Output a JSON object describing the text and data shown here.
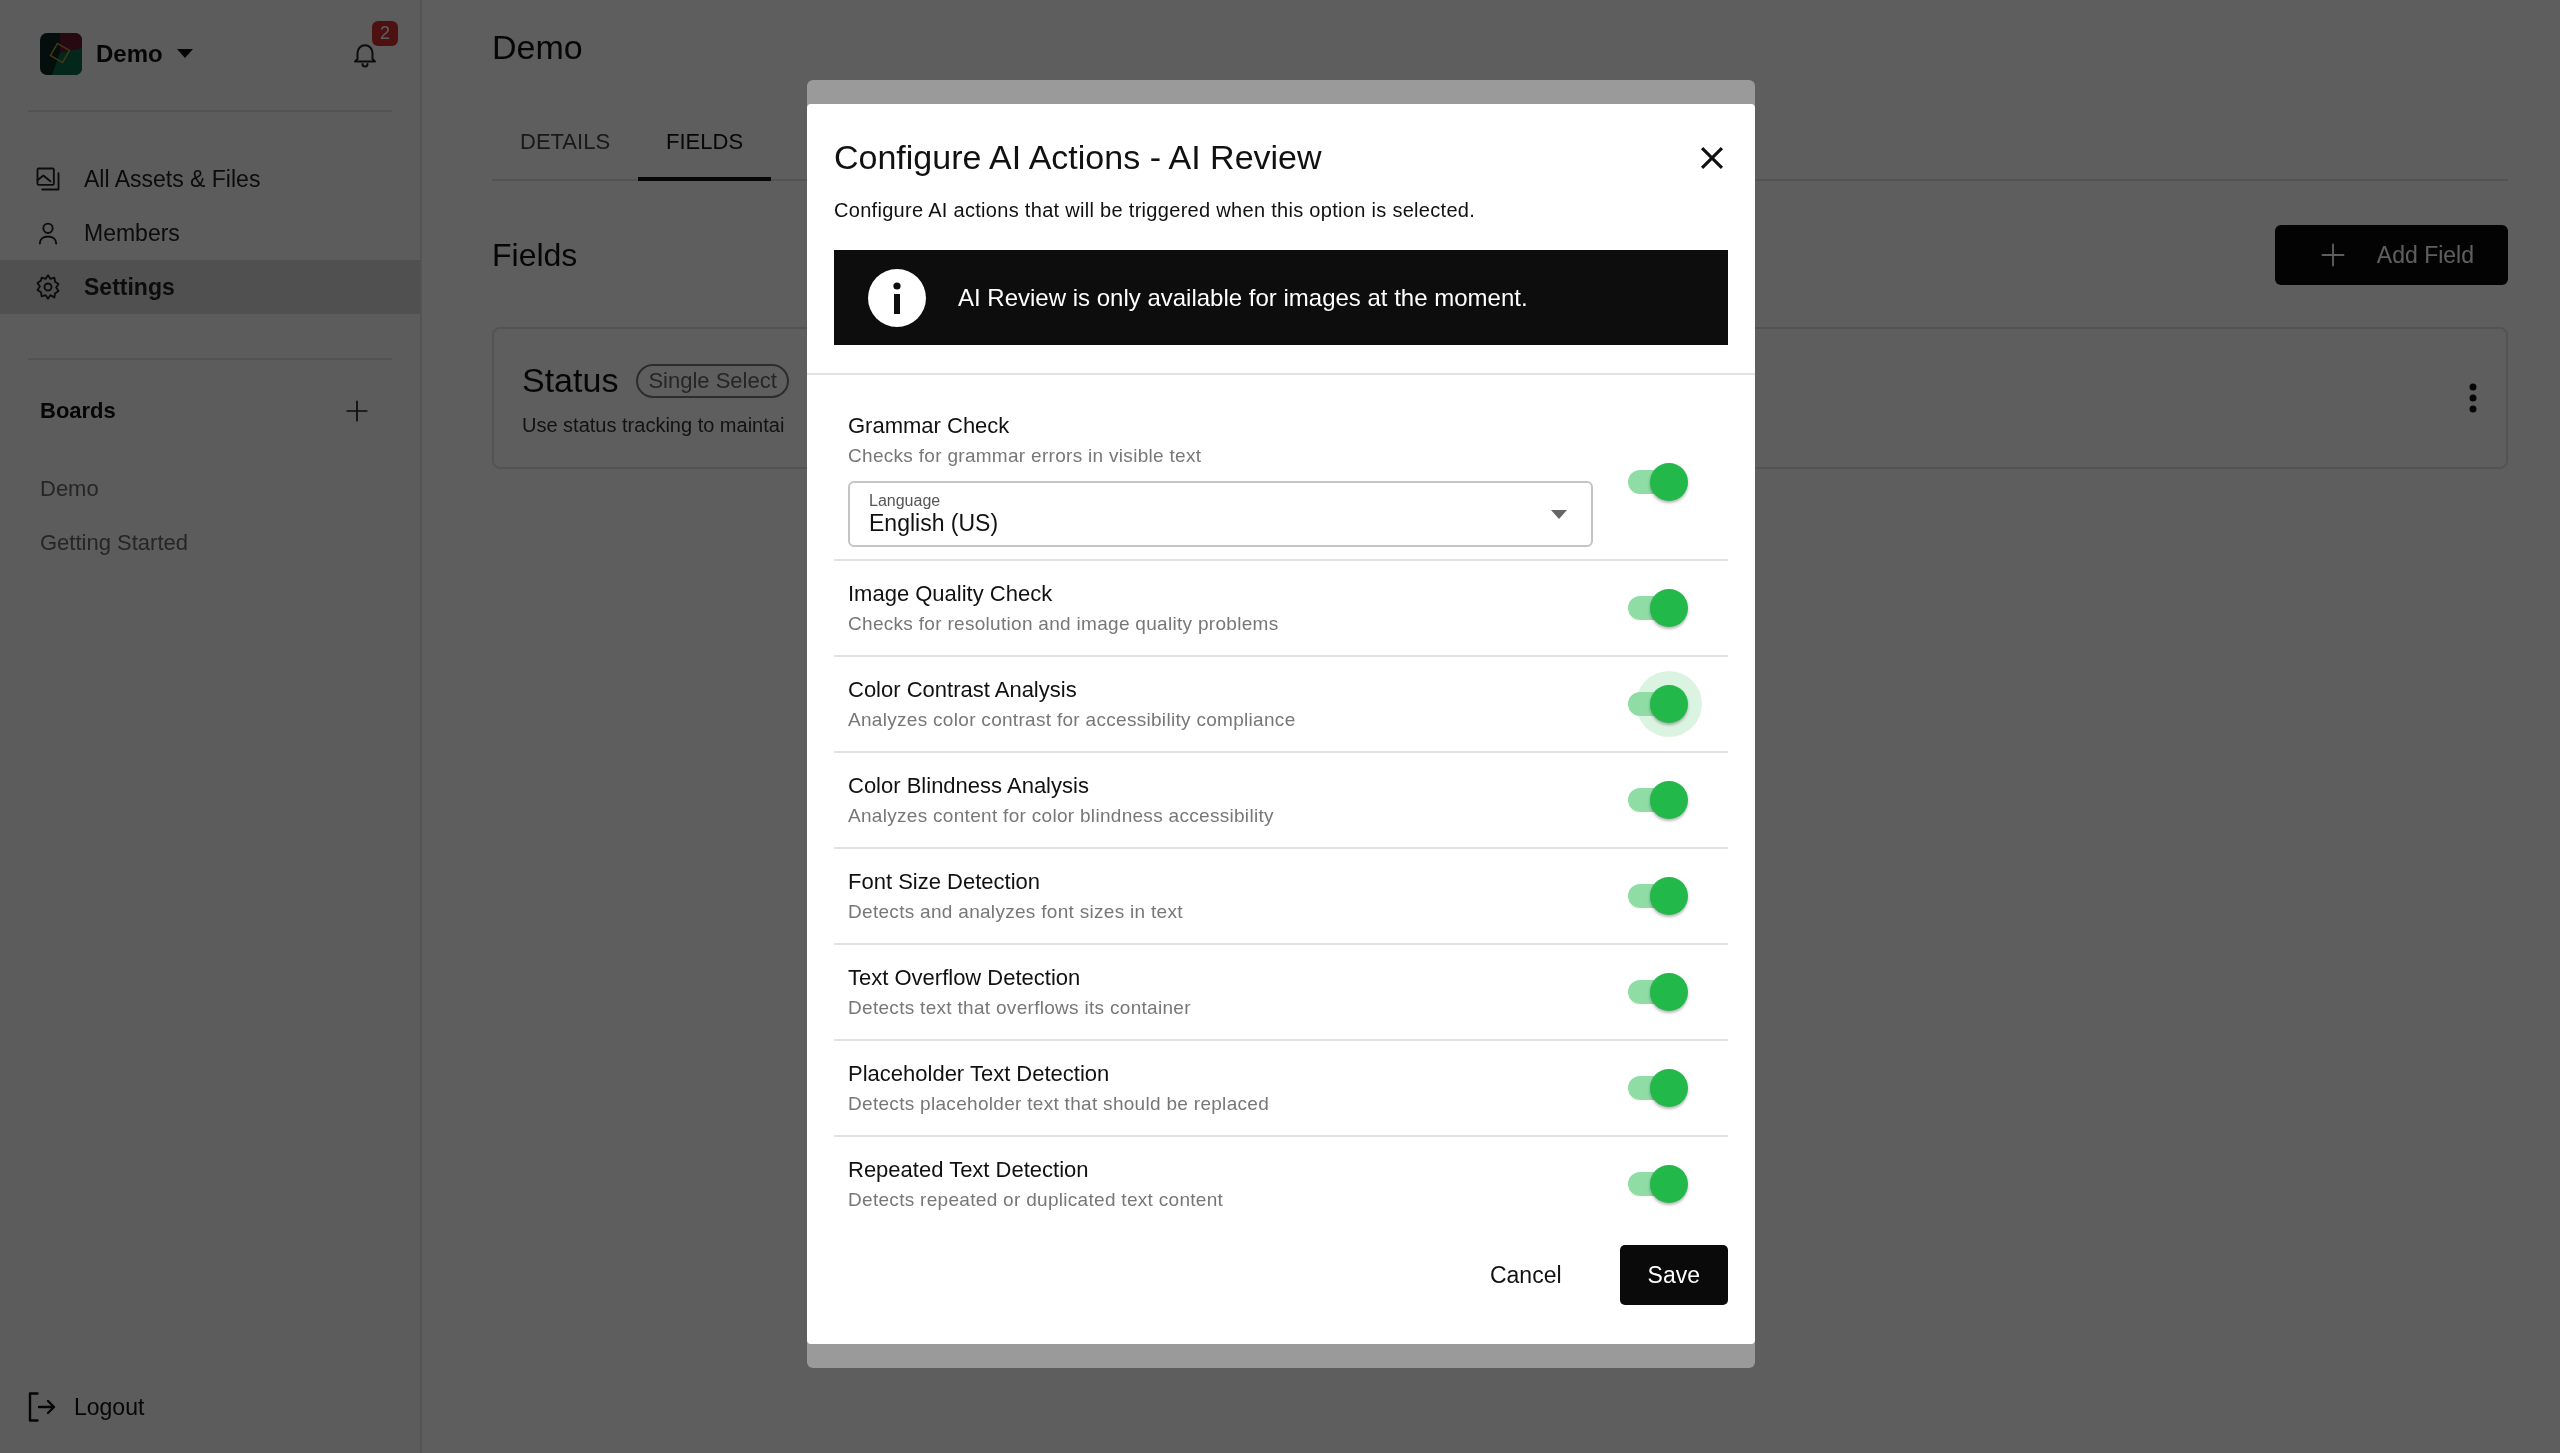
{
  "sidebar": {
    "workspace": "Demo",
    "notifications": "2",
    "nav": [
      {
        "label": "All Assets & Files",
        "selected": false
      },
      {
        "label": "Members",
        "selected": false
      },
      {
        "label": "Settings",
        "selected": true
      }
    ],
    "boards_title": "Boards",
    "boards": [
      "Demo",
      "Getting Started"
    ],
    "logout": "Logout"
  },
  "main": {
    "title": "Demo",
    "tabs": [
      {
        "label": "DETAILS",
        "selected": false
      },
      {
        "label": "FIELDS",
        "selected": true
      }
    ],
    "section_title": "Fields",
    "add_button": "Add Field",
    "field_card": {
      "name": "Status",
      "type": "Single Select",
      "description": "Use status tracking to maintai"
    }
  },
  "dialog": {
    "title": "Configure AI Actions - AI Review",
    "subtitle": "Configure AI actions that will be triggered when this option is selected.",
    "banner": "AI Review is only available for images at the moment.",
    "actions": [
      {
        "kind": "select",
        "title": "Grammar Check",
        "description": "Checks for grammar errors in visible text",
        "on": true,
        "focused": false,
        "select_label": "Language",
        "select_value": "English (US)"
      },
      {
        "kind": "plain",
        "title": "Image Quality Check",
        "description": "Checks for resolution and image quality problems",
        "on": true,
        "focused": false
      },
      {
        "kind": "plain",
        "title": "Color Contrast Analysis",
        "description": "Analyzes color contrast for accessibility compliance",
        "on": true,
        "focused": true
      },
      {
        "kind": "plain",
        "title": "Color Blindness Analysis",
        "description": "Analyzes content for color blindness accessibility",
        "on": true,
        "focused": false
      },
      {
        "kind": "plain",
        "title": "Font Size Detection",
        "description": "Detects and analyzes font sizes in text",
        "on": true,
        "focused": false
      },
      {
        "kind": "plain",
        "title": "Text Overflow Detection",
        "description": "Detects text that overflows its container",
        "on": true,
        "focused": false
      },
      {
        "kind": "plain",
        "title": "Placeholder Text Detection",
        "description": "Detects placeholder text that should be replaced",
        "on": true,
        "focused": false
      },
      {
        "kind": "plain",
        "title": "Repeated Text Detection",
        "description": "Detects repeated or duplicated text content",
        "on": true,
        "focused": false
      }
    ],
    "buttons": [
      {
        "kind": "text",
        "label": "Cancel"
      },
      {
        "kind": "primary",
        "label": "Save"
      }
    ]
  }
}
